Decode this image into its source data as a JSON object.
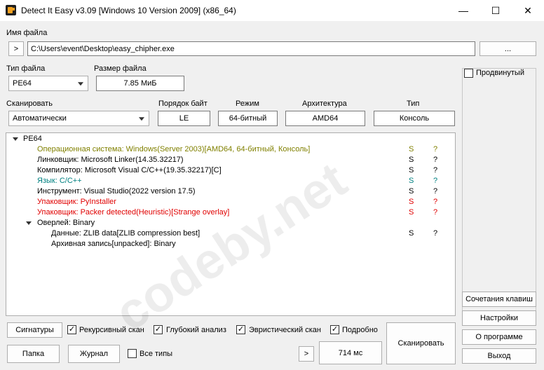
{
  "window": {
    "title": "Detect It Easy v3.09 [Windows 10 Version 2009] (x86_64)",
    "minimize": "—",
    "maximize": "☐",
    "close": "✕"
  },
  "file": {
    "label": "Имя файла",
    "expand_button": ">",
    "path": "C:\\Users\\event\\Desktop\\easy_chipher.exe",
    "browse_button": "..."
  },
  "file_type": {
    "label": "Тип файла",
    "value": "PE64"
  },
  "file_size": {
    "label": "Размер файла",
    "value": "7.85 МиБ"
  },
  "scan": {
    "label": "Сканировать",
    "value": "Автоматически"
  },
  "byte_order": {
    "label": "Порядок байт",
    "value": "LE"
  },
  "mode": {
    "label": "Режим",
    "value": "64-битный"
  },
  "arch": {
    "label": "Архитектура",
    "value": "AMD64"
  },
  "type": {
    "label": "Тип",
    "value": "Консоль"
  },
  "advanced": {
    "label": "Продвинутый",
    "checked": false
  },
  "results": [
    {
      "text": "PE64",
      "s": "",
      "q": "",
      "color": "default"
    },
    {
      "text": "Операционная система: Windows(Server 2003)[AMD64, 64-битный, Консоль]",
      "s": "S",
      "q": "?",
      "color": "olive"
    },
    {
      "text": "Линковщик: Microsoft Linker(14.35.32217)",
      "s": "S",
      "q": "?",
      "color": "default"
    },
    {
      "text": "Компилятор: Microsoft Visual C/C++(19.35.32217)[C]",
      "s": "S",
      "q": "?",
      "color": "default"
    },
    {
      "text": "Язык: C/C++",
      "s": "S",
      "q": "?",
      "color": "teal"
    },
    {
      "text": "Инструмент: Visual Studio(2022 version 17.5)",
      "s": "S",
      "q": "?",
      "color": "default"
    },
    {
      "text": "Упаковщик: PyInstaller",
      "s": "S",
      "q": "?",
      "color": "red"
    },
    {
      "text": "Упаковщик: Packer detected(Heuristic)[Strange overlay]",
      "s": "S",
      "q": "?",
      "color": "red"
    },
    {
      "text": "Оверлей: Binary",
      "s": "",
      "q": "",
      "color": "default"
    },
    {
      "text": "Данные: ZLIB data[ZLIB compression best]",
      "s": "S",
      "q": "?",
      "color": "default"
    },
    {
      "text": "Архивная запись[unpacked]: Binary",
      "s": "",
      "q": "",
      "color": "default"
    }
  ],
  "watermark": "codeby.net",
  "bottom": {
    "signatures": "Сигнатуры",
    "recursive": "Рекурсивный скан",
    "deep": "Глубокий анализ",
    "heuristic": "Эвристический скан",
    "verbose": "Подробно",
    "folder": "Папка",
    "log": "Журнал",
    "all_types": "Все типы",
    "next": ">",
    "time": "714 мс",
    "scan_button": "Сканировать"
  },
  "side": {
    "shortcuts": "Сочетания клавиш",
    "settings": "Настройки",
    "about": "О программе",
    "exit": "Выход"
  },
  "colors": {
    "olive": "#808000",
    "teal": "#008080",
    "red": "#e00000"
  }
}
